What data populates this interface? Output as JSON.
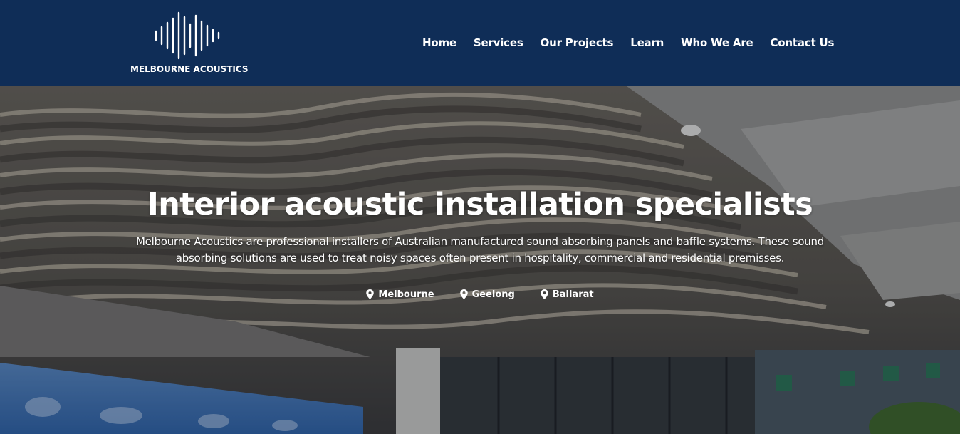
{
  "logo": {
    "text": "MELBOURNE ACOUSTICS",
    "icon": "soundwave-icon"
  },
  "nav": {
    "items": [
      {
        "label": "Home"
      },
      {
        "label": "Services"
      },
      {
        "label": "Our Projects"
      },
      {
        "label": "Learn"
      },
      {
        "label": "Who We Are"
      },
      {
        "label": "Contact Us"
      }
    ]
  },
  "hero": {
    "title": "Interior acoustic installation specialists",
    "description": "Melbourne Acoustics are professional installers of Australian manufactured sound absorbing panels and baffle systems. These sound absorbing solutions are used to treat noisy spaces often present in hospitality, commercial and residential premisses.",
    "locations": [
      {
        "label": "Melbourne",
        "icon": "map-pin-icon"
      },
      {
        "label": "Geelong",
        "icon": "map-pin-icon"
      },
      {
        "label": "Ballarat",
        "icon": "map-pin-icon"
      }
    ]
  },
  "colors": {
    "header_bg": "#0f2d57",
    "text": "#ffffff"
  }
}
